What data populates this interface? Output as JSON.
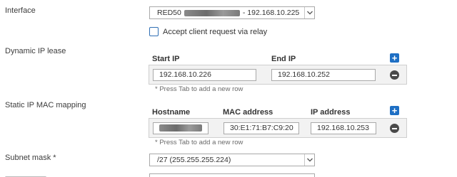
{
  "interface": {
    "label": "Interface",
    "value_prefix": "RED50",
    "value_suffix": "- 192.168.10.225"
  },
  "relay": {
    "label": "Accept client request via relay",
    "checked": false
  },
  "dynamic_lease": {
    "label": "Dynamic IP lease",
    "columns": [
      "Start IP",
      "End IP"
    ],
    "rows": [
      {
        "start_ip": "192.168.10.226",
        "end_ip": "192.168.10.252"
      }
    ],
    "hint": "* Press Tab to add a new row"
  },
  "static_mapping": {
    "label": "Static IP MAC mapping",
    "columns": [
      "Hostname",
      "MAC address",
      "IP address"
    ],
    "rows": [
      {
        "hostname": "",
        "mac": "30:E1:71:B7:C9:20",
        "ip": "192.168.10.253"
      }
    ],
    "hint": "* Press Tab to add a new row"
  },
  "subnet": {
    "label": "Subnet mask *",
    "value": "/27 (255.255.255.224)"
  },
  "icons": {
    "add": "plus-icon",
    "remove": "minus-circle-icon",
    "dropdown": "chevron-down-icon"
  },
  "colors": {
    "accent": "#1e6fc4",
    "remove_button": "#4a4a4a",
    "row_background": "#f2f2f2"
  }
}
